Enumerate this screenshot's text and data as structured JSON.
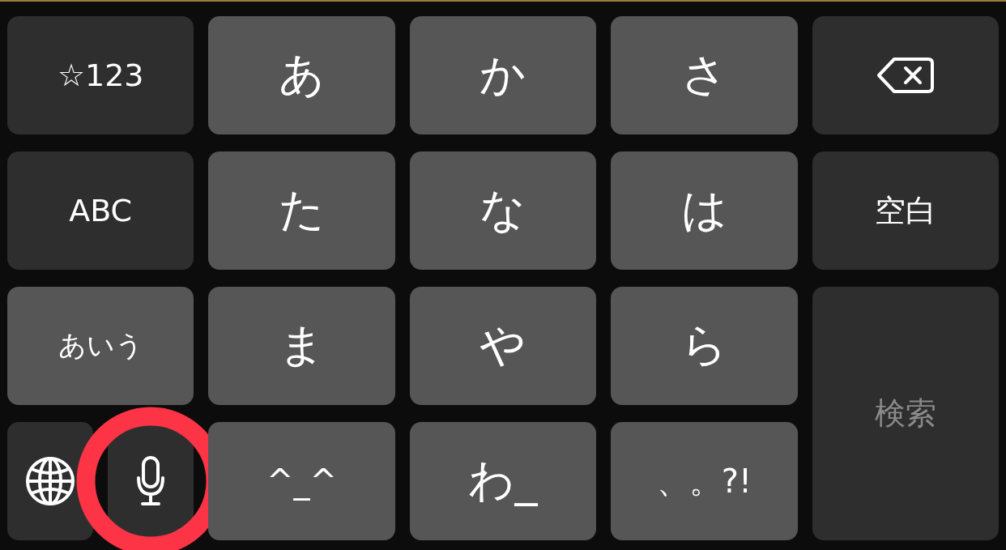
{
  "rows": [
    [
      {
        "kind": "function",
        "label": "☆123"
      },
      {
        "kind": "letter",
        "label": "あ"
      },
      {
        "kind": "letter",
        "label": "か"
      },
      {
        "kind": "letter",
        "label": "さ"
      },
      {
        "kind": "backspace"
      }
    ],
    [
      {
        "kind": "function",
        "label": "ABC"
      },
      {
        "kind": "letter",
        "label": "た"
      },
      {
        "kind": "letter",
        "label": "な"
      },
      {
        "kind": "letter",
        "label": "は"
      },
      {
        "kind": "function",
        "label": "空白"
      }
    ],
    [
      {
        "kind": "letter-small",
        "label": "あいう"
      },
      {
        "kind": "letter",
        "label": "ま"
      },
      {
        "kind": "letter",
        "label": "や"
      },
      {
        "kind": "letter",
        "label": "ら"
      },
      {
        "kind": "search",
        "label": "検索",
        "disabled": true
      }
    ],
    [
      {
        "kind": "group",
        "keys": [
          {
            "kind": "globe"
          },
          {
            "kind": "mic",
            "highlighted": true
          }
        ]
      },
      {
        "kind": "letter-mid",
        "label": "^_^"
      },
      {
        "kind": "letter",
        "label": "わ_"
      },
      {
        "kind": "letter-mid",
        "label": "、。?!"
      }
    ]
  ]
}
